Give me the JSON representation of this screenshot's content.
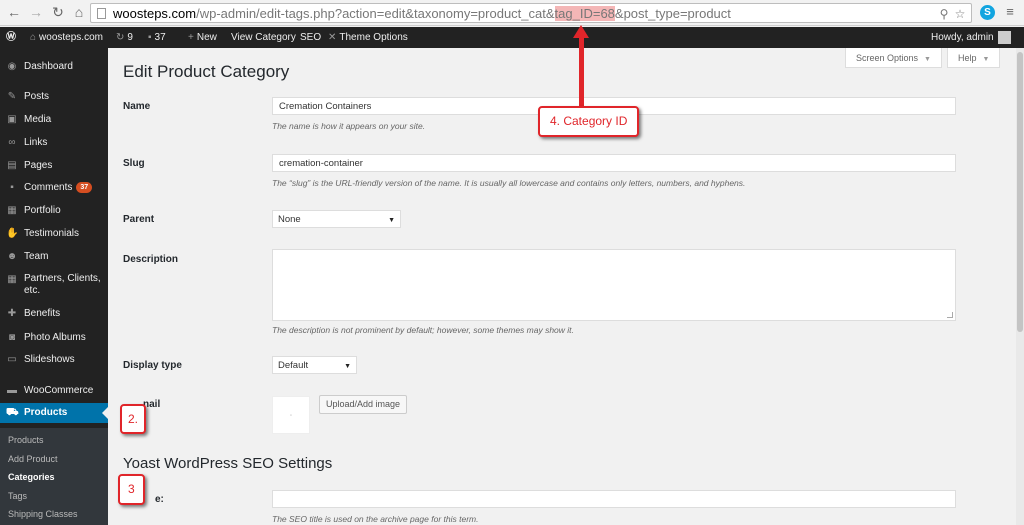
{
  "browser": {
    "url_host": "woosteps.com",
    "url_before_highlight": "/wp-admin/edit-tags.php?action=edit&taxonomy=product_cat&",
    "url_highlight": "tag_ID=68",
    "url_after_highlight": "&post_type=product",
    "skype_label": "S"
  },
  "adminbar": {
    "site_name": "woosteps.com",
    "updates_count": "9",
    "comments_count": "37",
    "new_label": "New",
    "view_category_label": "View Category",
    "seo_label": "SEO",
    "theme_options_label": "Theme Options",
    "howdy": "Howdy, admin"
  },
  "sidebar": {
    "items": [
      {
        "label": "Dashboard"
      },
      {
        "label": "Posts"
      },
      {
        "label": "Media"
      },
      {
        "label": "Links"
      },
      {
        "label": "Pages"
      },
      {
        "label": "Comments",
        "badge": "37"
      },
      {
        "label": "Portfolio"
      },
      {
        "label": "Testimonials"
      },
      {
        "label": "Team"
      },
      {
        "label": "Partners, Clients, etc."
      },
      {
        "label": "Benefits"
      },
      {
        "label": "Photo Albums"
      },
      {
        "label": "Slideshows"
      },
      {
        "label": "WooCommerce"
      },
      {
        "label": "Products"
      }
    ],
    "submenu": [
      "Products",
      "Add Product",
      "Categories",
      "Tags",
      "Shipping Classes"
    ]
  },
  "screen_options": {
    "screen_label": "Screen Options",
    "help_label": "Help"
  },
  "page": {
    "title": "Edit Product Category",
    "name_label": "Name",
    "name_value": "Cremation Containers",
    "name_desc": "The name is how it appears on your site.",
    "slug_label": "Slug",
    "slug_value": "cremation-container",
    "slug_desc": "The “slug” is the URL-friendly version of the name. It is usually all lowercase and contains only letters, numbers, and hyphens.",
    "parent_label": "Parent",
    "parent_value": "None",
    "description_label": "Description",
    "description_desc": "The description is not prominent by default; however, some themes may show it.",
    "display_type_label": "Display type",
    "display_type_value": "Default",
    "thumbnail_label_partial": "nail",
    "upload_button": "Upload/Add image",
    "seo_section_title": "Yoast WordPress SEO Settings",
    "seo_title_label_partial": "e:",
    "seo_title_desc": "The SEO title is used on the archive page for this term."
  },
  "annotations": {
    "category_id": "4. Category ID",
    "step2": "2.",
    "step3": "3"
  },
  "colors": {
    "admin_bar": "#222222",
    "active_menu": "#0073aa",
    "annotation": "#e0252a",
    "badge": "#d54e21"
  }
}
